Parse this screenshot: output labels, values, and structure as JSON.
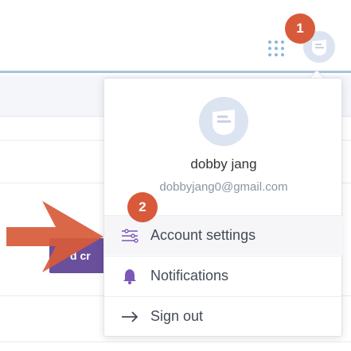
{
  "user": {
    "name": "dobby jang",
    "email": "dobbyjang0@gmail.com"
  },
  "menu": {
    "items": [
      {
        "label": "Account settings",
        "icon": "settings-sliders-icon"
      },
      {
        "label": "Notifications",
        "icon": "bell-icon"
      },
      {
        "label": "Sign out",
        "icon": "arrow-right-icon"
      }
    ]
  },
  "background": {
    "button_fragment": "d cr"
  },
  "annotations": {
    "step1": "1",
    "step2": "2"
  },
  "colors": {
    "badge": "#d85a3a",
    "icon_purple": "#7a57b8",
    "apps_blue": "#8ab6dc",
    "header_border": "#a8c2dc"
  }
}
